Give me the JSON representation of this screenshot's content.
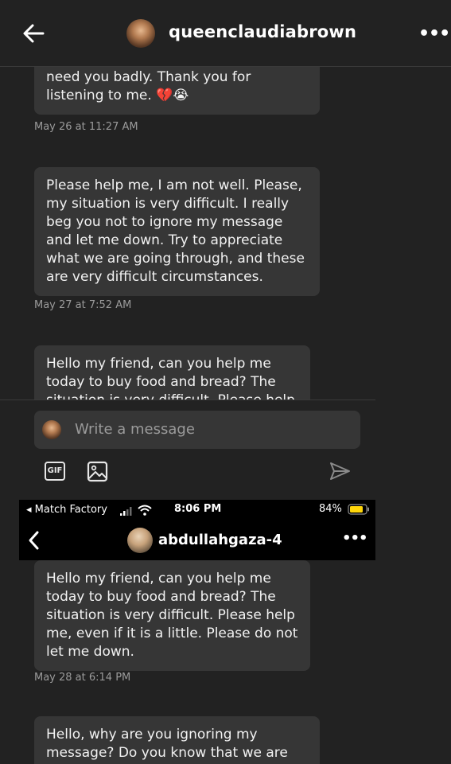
{
  "header": {
    "username": "queenclaudiabrown",
    "more_label": "•••"
  },
  "messages": [
    {
      "text": "my message as soon as possible, we need you badly. Thank you for listening to me. 💔😭",
      "visible_lines": [
        "need you badly. Thank you for",
        "listening to me. 💔😭"
      ],
      "timestamp": "May 26 at 11:27 AM"
    },
    {
      "text": "Please help me, I am not well. Please, my situation is very difficult. I really beg you not to ignore my message and let me down. Try to appreciate what we are going through, and these are very difficult circumstances.",
      "timestamp": "May 27 at 7:52 AM"
    },
    {
      "text": "Hello my friend, can you help me today to buy food and bread? The situation is very difficult. Please help"
    }
  ],
  "composer": {
    "placeholder": "Write a message",
    "gif_label": "GIF"
  },
  "embedded": {
    "status_bar": {
      "carrier": "◂ Match Factory",
      "time": "8:06 PM",
      "battery": "84%",
      "battery_level": 0.84
    },
    "header": {
      "username": "abdullahgaza-4",
      "more_label": "•••"
    },
    "messages": [
      {
        "text": "Hello my friend, can you help me today to buy food and bread? The situation is very difficult. Please help me, even if it is a little. Please do not let me down.",
        "timestamp": "May 28 at 6:14 PM"
      },
      {
        "text": "Hello, why are you ignoring my message? Do you know that we are"
      }
    ]
  },
  "colors": {
    "background": "#222222",
    "bubble": "#363636",
    "timestamp": "#9b9b9b",
    "battery": "#ffd60a"
  }
}
